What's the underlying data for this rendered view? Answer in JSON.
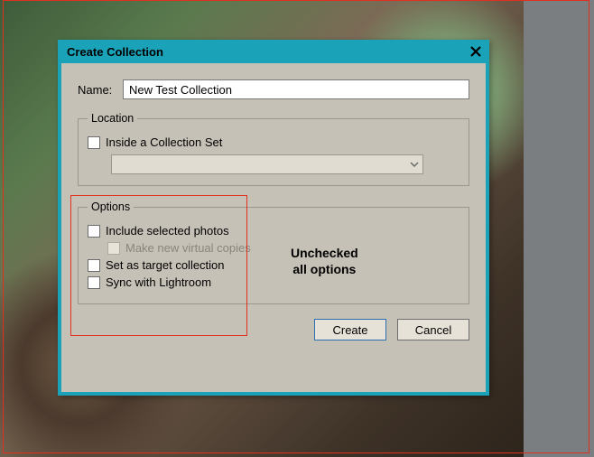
{
  "dialog": {
    "title": "Create Collection",
    "name_label": "Name:",
    "name_value": "New Test Collection",
    "location": {
      "legend": "Location",
      "inside_set_label": "Inside a Collection Set",
      "inside_set_checked": false,
      "selected_set": ""
    },
    "options": {
      "legend": "Options",
      "include_selected_label": "Include selected photos",
      "include_selected_checked": false,
      "virtual_copies_label": "Make new virtual copies",
      "virtual_copies_checked": false,
      "virtual_copies_enabled": false,
      "target_collection_label": "Set as target collection",
      "target_collection_checked": false,
      "sync_label": "Sync with Lightroom",
      "sync_checked": false
    },
    "buttons": {
      "create": "Create",
      "cancel": "Cancel"
    }
  },
  "annotation": {
    "line1": "Unchecked",
    "line2": "all options"
  }
}
